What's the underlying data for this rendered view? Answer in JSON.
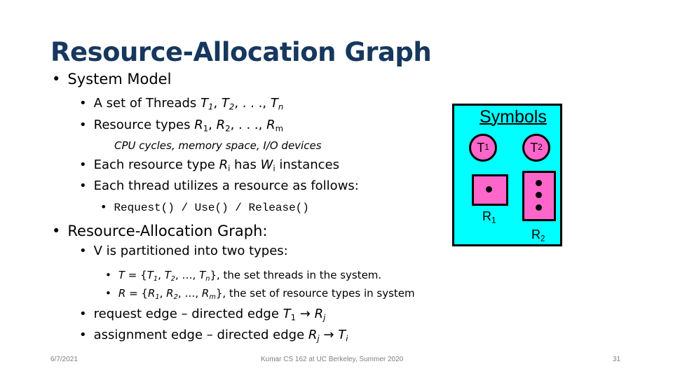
{
  "slide": {
    "title": "Resource-Allocation Graph",
    "system_model": {
      "heading": "System Model",
      "threads_prefix": "A set of Threads ",
      "threads": [
        "T",
        "1",
        ", ",
        "T",
        "2",
        ", . . ., ",
        "T",
        "n"
      ],
      "resources_prefix": "Resource types ",
      "resources": [
        "R",
        "1",
        ", ",
        "R",
        "2",
        ", . . ., ",
        "R",
        "m"
      ],
      "resource_examples": "CPU cycles, memory space, I/O devices",
      "instances": {
        "pre": "Each resource type ",
        "R": "R",
        "i": "i",
        "mid": " has ",
        "W": "W",
        "wi": "i",
        "post": " instances"
      },
      "utilization": "Each thread utilizes a resource as follows:",
      "operations": "Request() / Use() / Release()"
    },
    "rag": {
      "heading": "Resource-Allocation Graph:",
      "partition": "V is partitioned into two types:",
      "set_T": {
        "lhs": "T",
        "eq": " = {",
        "a": "T",
        "a_sub": "1",
        "sep1": ", ",
        "b": "T",
        "b_sub": "2",
        "sep2": ", …, ",
        "c": "T",
        "c_sub": "n",
        "tail": "}, the set threads in the system."
      },
      "set_R": {
        "lhs": "R",
        "eq": " = {",
        "a": "R",
        "a_sub": "1",
        "sep1": ", ",
        "b": "R",
        "b_sub": "2",
        "sep2": ", …, ",
        "c": "R",
        "c_sub": "m",
        "tail": "}, the set of resource types in system"
      },
      "request_edge": {
        "text": "request edge – directed edge ",
        "from": "T",
        "from_sub": "1",
        "arrow": " → ",
        "to": "R",
        "to_sub": "j"
      },
      "assignment_edge": {
        "text": "assignment edge – directed edge ",
        "from": "R",
        "from_sub": "j",
        "arrow": " → ",
        "to": "T",
        "to_sub": "i"
      }
    },
    "symbols": {
      "title": "Symbols",
      "thread1": {
        "label": "T",
        "sub": "1"
      },
      "thread2": {
        "label": "T",
        "sub": "2"
      },
      "resource1": {
        "label": "R",
        "sub": "1",
        "instances": 1
      },
      "resource2": {
        "label": "R",
        "sub": "2",
        "instances": 3
      },
      "colors": {
        "background": "#00ffff",
        "node": "#ff66cc",
        "border": "#000000"
      }
    },
    "footer": {
      "date": "6/7/2021",
      "course": "Kumar CS 162 at UC Berkeley, Summer 2020",
      "page": "31"
    },
    "colors": {
      "title": "#16375e"
    }
  }
}
